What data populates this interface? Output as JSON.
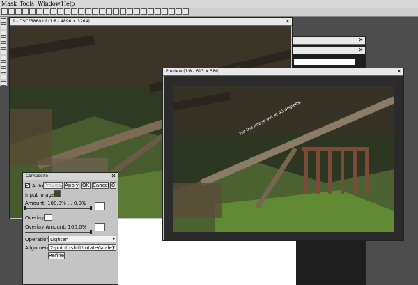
{
  "menu": [
    "Mask",
    "Tools",
    "Window",
    "Help"
  ],
  "main_window": {
    "title": "1 - DSCF5860.tif (1:8 - 4896 × 3264)"
  },
  "back_window_1": {
    "title": ""
  },
  "back_window_2": {
    "title": ""
  },
  "preview_window": {
    "title": "Preview (1:8 - 613 × 586)",
    "overlay_text": "Put the image out at 45 degrees."
  },
  "composite": {
    "title": "Composite",
    "auto_label": "Auto",
    "auto_checked": true,
    "preview_label": "Preview",
    "apply_label": "Apply",
    "ok_label": "OK",
    "cancel_label": "Cancel",
    "input_image_label": "Input Image:",
    "amount_label": "Amount: 100.0% ... 0.0%",
    "overlay_label": "Overlay",
    "overlay_amount_label": "Overlay Amount: 100.0%",
    "operation_label": "Operation:",
    "operation_value": "Lighten",
    "alignment_label": "Alignment:",
    "alignment_value": "2-point (shift/rotate/scale)",
    "refine_label": "Refine"
  },
  "colors": {
    "desktop": "#4d4d4d",
    "window_chrome": "#c4c4c4",
    "preview_bg": "#2b2b2b"
  }
}
